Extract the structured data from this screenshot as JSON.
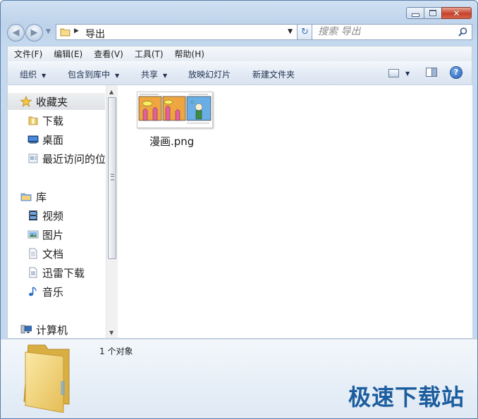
{
  "window": {
    "caption_buttons": [
      "minimize",
      "maximize",
      "close"
    ]
  },
  "address_bar": {
    "current_folder": "导出"
  },
  "search": {
    "placeholder": "搜索 导出"
  },
  "menu": [
    "文件(F)",
    "编辑(E)",
    "查看(V)",
    "工具(T)",
    "帮助(H)"
  ],
  "toolbar": {
    "organize": "组织",
    "include_in_library": "包含到库中",
    "share": "共享",
    "slideshow": "放映幻灯片",
    "new_folder": "新建文件夹",
    "help_label": "?"
  },
  "sidebar": {
    "favorites": {
      "label": "收藏夹",
      "items": [
        "下载",
        "桌面",
        "最近访问的位置"
      ]
    },
    "libraries": {
      "label": "库",
      "items": [
        "视频",
        "图片",
        "文档",
        "迅雷下载",
        "音乐"
      ]
    },
    "computer": {
      "label": "计算机"
    }
  },
  "files": [
    {
      "name": "漫画.png",
      "type": "png-image"
    }
  ],
  "details_pane": {
    "status": "1 个对象"
  },
  "watermark": "极速下载站",
  "colors": {
    "accent": "#1c5d9e",
    "close_button": "#c7422b",
    "chrome": "#bed3ea"
  }
}
